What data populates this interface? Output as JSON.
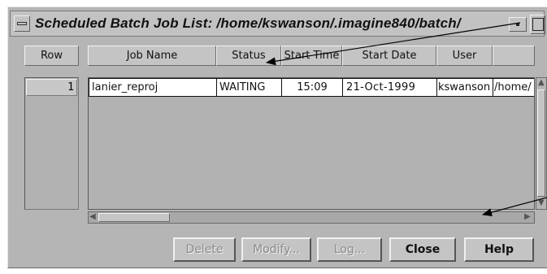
{
  "window": {
    "title": "Scheduled Batch Job List: /home/kswanson/.imagine840/batch/"
  },
  "table": {
    "columns": [
      "Row",
      "Job Name",
      "Status",
      "Start Time",
      "Start Date",
      "User",
      ""
    ],
    "rows": [
      {
        "row": "1",
        "cells": [
          "lanier_reproj",
          "WAITING",
          "15:09",
          "21-Oct-1999",
          "kswanson",
          "/home/"
        ]
      }
    ]
  },
  "buttons": {
    "delete": "Delete",
    "modify": "Modify...",
    "log": "Log...",
    "close": "Close",
    "help": "Help"
  },
  "icons": {
    "window_menu": "window-menu-icon",
    "minimize": "minimize-icon",
    "maximize": "maximize-icon",
    "scroll_up": "triangle-up-icon",
    "scroll_down": "triangle-down-icon",
    "scroll_left": "triangle-left-icon",
    "scroll_right": "triangle-right-icon"
  },
  "colors": {
    "window_bg": "#b5b5b5",
    "cell_bg": "#ffffff",
    "disabled_text": "#8a8a8a",
    "callout_arrow": "#000000"
  }
}
